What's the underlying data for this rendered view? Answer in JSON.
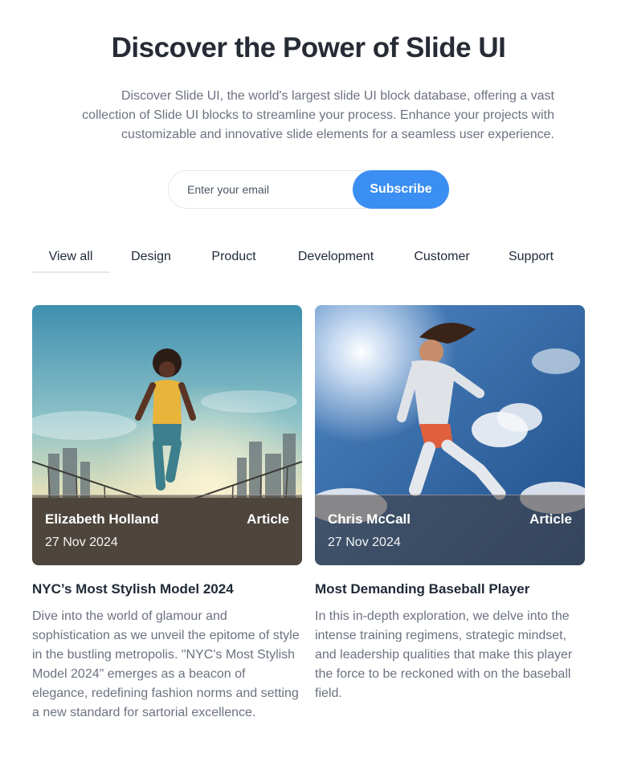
{
  "hero": {
    "title": "Discover the Power of Slide UI",
    "subtitle": "Discover Slide UI, the world's largest slide UI block database, offering a vast collection of Slide UI blocks to streamline your process. Enhance your projects with customizable and innovative slide elements for a seamless user experience."
  },
  "subscribe": {
    "placeholder": "Enter your email",
    "button_label": "Subscribe",
    "accent": "#3b8ef2"
  },
  "tabs": [
    {
      "label": "View all",
      "active": true
    },
    {
      "label": "Design",
      "active": false
    },
    {
      "label": "Product",
      "active": false
    },
    {
      "label": "Development",
      "active": false
    },
    {
      "label": "Customer",
      "active": false
    },
    {
      "label": "Support",
      "active": false
    }
  ],
  "cards": [
    {
      "image_icon": "runner-photo",
      "author": "Elizabeth Holland",
      "type": "Article",
      "date": "27 Nov 2024",
      "title": "NYC’s Most Stylish Model 2024",
      "description": "Dive into the world of glamour and sophistication as we unveil the epitome of style in the bustling metropolis. \"NYC's Most Stylish Model 2024\" emerges as a beacon of elegance, redefining fashion norms and setting a new standard for sartorial excellence."
    },
    {
      "image_icon": "athlete-leaping-photo",
      "author": "Chris McCall",
      "type": "Article",
      "date": "27 Nov 2024",
      "title": "Most Demanding Baseball Player",
      "description": "In this in-depth exploration, we delve into the intense training regimens, strategic mindset, and leadership qualities that make this player the force to be reckoned with on the baseball field."
    }
  ]
}
